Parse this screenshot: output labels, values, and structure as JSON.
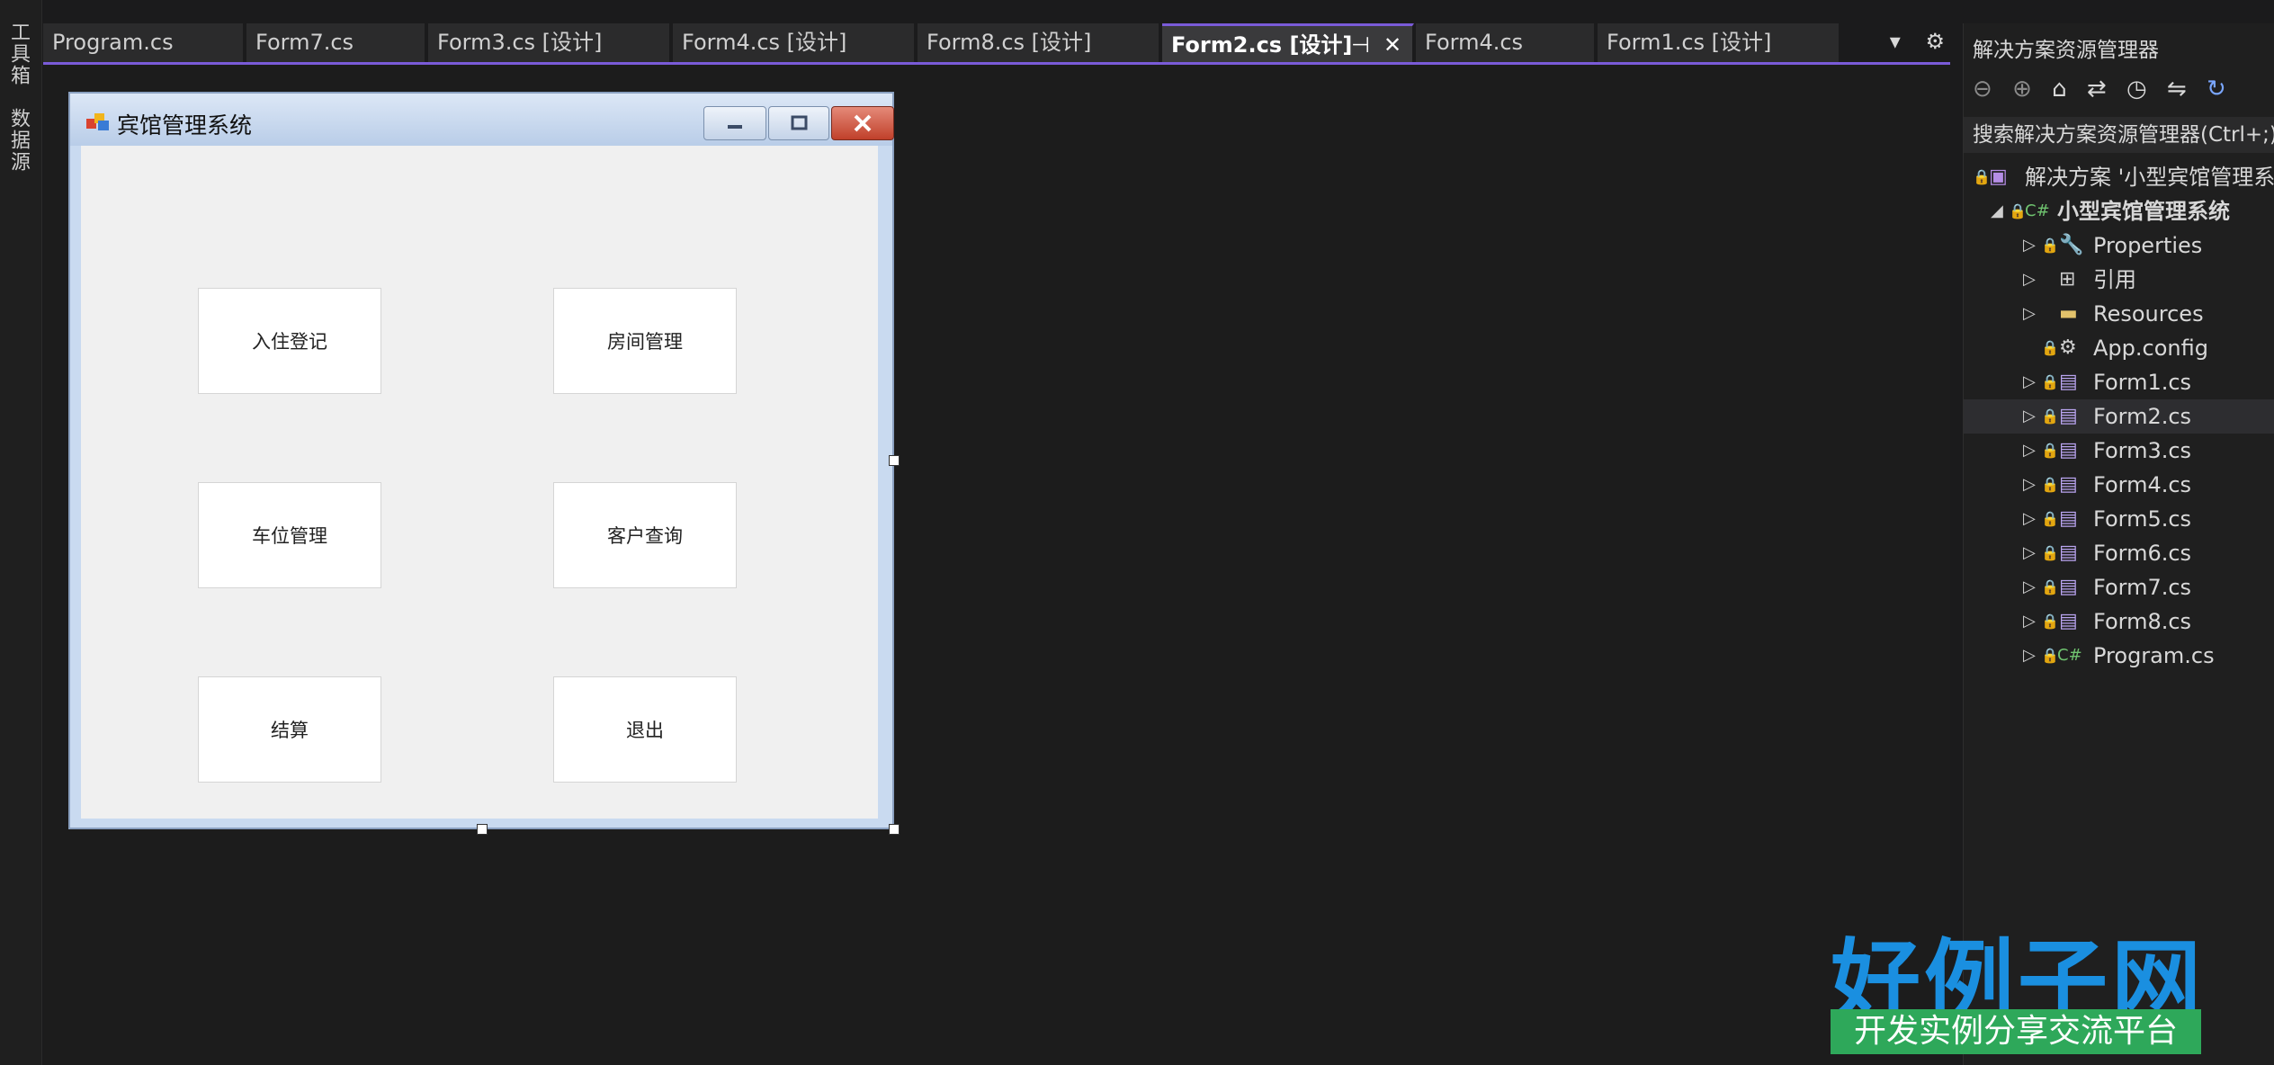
{
  "sidebar": {
    "toolbox_label": "工具箱",
    "datasource_label": "数据源"
  },
  "tabs": [
    {
      "label": "Program.cs"
    },
    {
      "label": "Form7.cs"
    },
    {
      "label": "Form3.cs [设计]"
    },
    {
      "label": "Form4.cs [设计]"
    },
    {
      "label": "Form8.cs [设计]"
    },
    {
      "label": "Form2.cs [设计]",
      "active": true
    },
    {
      "label": "Form4.cs"
    },
    {
      "label": "Form1.cs [设计]"
    }
  ],
  "tab_icons": {
    "pin": "pin-icon",
    "close": "close-icon",
    "dropdown": "dropdown-icon",
    "settings": "gear-icon"
  },
  "form": {
    "title": "宾馆管理系统",
    "buttons": [
      "入住登记",
      "房间管理",
      "车位管理",
      "客户查询",
      "结算",
      "退出"
    ]
  },
  "solution_explorer": {
    "title": "解决方案资源管理器",
    "search_placeholder": "搜索解决方案资源管理器(Ctrl+;)",
    "solution": "解决方案 '小型宾馆管理系统'",
    "project": "小型宾馆管理系统",
    "items": [
      {
        "label": "Properties",
        "icon": "wrench-icon"
      },
      {
        "label": "引用",
        "icon": "references-icon"
      },
      {
        "label": "Resources",
        "icon": "folder-icon"
      },
      {
        "label": "App.config",
        "icon": "config-file-icon"
      },
      {
        "label": "Form1.cs",
        "icon": "form-icon"
      },
      {
        "label": "Form2.cs",
        "icon": "form-icon",
        "selected": true
      },
      {
        "label": "Form3.cs",
        "icon": "form-icon"
      },
      {
        "label": "Form4.cs",
        "icon": "form-icon"
      },
      {
        "label": "Form5.cs",
        "icon": "form-icon"
      },
      {
        "label": "Form6.cs",
        "icon": "form-icon"
      },
      {
        "label": "Form7.cs",
        "icon": "form-icon"
      },
      {
        "label": "Form8.cs",
        "icon": "form-icon"
      },
      {
        "label": "Program.cs",
        "icon": "csharp-icon"
      }
    ]
  },
  "watermark": {
    "brand": "好例子网",
    "slogan": "开发实例分享交流平台"
  },
  "colors": {
    "accent": "#7a5bd8",
    "brand_blue": "#1a8fe0",
    "brand_green": "#2ea85a"
  }
}
